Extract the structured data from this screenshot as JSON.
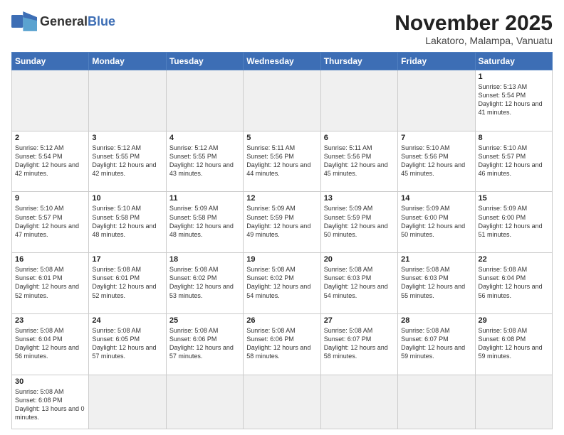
{
  "header": {
    "logo_general": "General",
    "logo_blue": "Blue",
    "month_title": "November 2025",
    "location": "Lakatoro, Malampa, Vanuatu"
  },
  "days_of_week": [
    "Sunday",
    "Monday",
    "Tuesday",
    "Wednesday",
    "Thursday",
    "Friday",
    "Saturday"
  ],
  "weeks": [
    [
      {
        "day": "",
        "info": "",
        "empty": true
      },
      {
        "day": "",
        "info": "",
        "empty": true
      },
      {
        "day": "",
        "info": "",
        "empty": true
      },
      {
        "day": "",
        "info": "",
        "empty": true
      },
      {
        "day": "",
        "info": "",
        "empty": true
      },
      {
        "day": "",
        "info": "",
        "empty": true
      },
      {
        "day": "1",
        "info": "Sunrise: 5:13 AM\nSunset: 5:54 PM\nDaylight: 12 hours\nand 41 minutes."
      }
    ],
    [
      {
        "day": "2",
        "info": "Sunrise: 5:12 AM\nSunset: 5:54 PM\nDaylight: 12 hours\nand 42 minutes."
      },
      {
        "day": "3",
        "info": "Sunrise: 5:12 AM\nSunset: 5:55 PM\nDaylight: 12 hours\nand 42 minutes."
      },
      {
        "day": "4",
        "info": "Sunrise: 5:12 AM\nSunset: 5:55 PM\nDaylight: 12 hours\nand 43 minutes."
      },
      {
        "day": "5",
        "info": "Sunrise: 5:11 AM\nSunset: 5:56 PM\nDaylight: 12 hours\nand 44 minutes."
      },
      {
        "day": "6",
        "info": "Sunrise: 5:11 AM\nSunset: 5:56 PM\nDaylight: 12 hours\nand 45 minutes."
      },
      {
        "day": "7",
        "info": "Sunrise: 5:10 AM\nSunset: 5:56 PM\nDaylight: 12 hours\nand 45 minutes."
      },
      {
        "day": "8",
        "info": "Sunrise: 5:10 AM\nSunset: 5:57 PM\nDaylight: 12 hours\nand 46 minutes."
      }
    ],
    [
      {
        "day": "9",
        "info": "Sunrise: 5:10 AM\nSunset: 5:57 PM\nDaylight: 12 hours\nand 47 minutes."
      },
      {
        "day": "10",
        "info": "Sunrise: 5:10 AM\nSunset: 5:58 PM\nDaylight: 12 hours\nand 48 minutes."
      },
      {
        "day": "11",
        "info": "Sunrise: 5:09 AM\nSunset: 5:58 PM\nDaylight: 12 hours\nand 48 minutes."
      },
      {
        "day": "12",
        "info": "Sunrise: 5:09 AM\nSunset: 5:59 PM\nDaylight: 12 hours\nand 49 minutes."
      },
      {
        "day": "13",
        "info": "Sunrise: 5:09 AM\nSunset: 5:59 PM\nDaylight: 12 hours\nand 50 minutes."
      },
      {
        "day": "14",
        "info": "Sunrise: 5:09 AM\nSunset: 6:00 PM\nDaylight: 12 hours\nand 50 minutes."
      },
      {
        "day": "15",
        "info": "Sunrise: 5:09 AM\nSunset: 6:00 PM\nDaylight: 12 hours\nand 51 minutes."
      }
    ],
    [
      {
        "day": "16",
        "info": "Sunrise: 5:08 AM\nSunset: 6:01 PM\nDaylight: 12 hours\nand 52 minutes."
      },
      {
        "day": "17",
        "info": "Sunrise: 5:08 AM\nSunset: 6:01 PM\nDaylight: 12 hours\nand 52 minutes."
      },
      {
        "day": "18",
        "info": "Sunrise: 5:08 AM\nSunset: 6:02 PM\nDaylight: 12 hours\nand 53 minutes."
      },
      {
        "day": "19",
        "info": "Sunrise: 5:08 AM\nSunset: 6:02 PM\nDaylight: 12 hours\nand 54 minutes."
      },
      {
        "day": "20",
        "info": "Sunrise: 5:08 AM\nSunset: 6:03 PM\nDaylight: 12 hours\nand 54 minutes."
      },
      {
        "day": "21",
        "info": "Sunrise: 5:08 AM\nSunset: 6:03 PM\nDaylight: 12 hours\nand 55 minutes."
      },
      {
        "day": "22",
        "info": "Sunrise: 5:08 AM\nSunset: 6:04 PM\nDaylight: 12 hours\nand 56 minutes."
      }
    ],
    [
      {
        "day": "23",
        "info": "Sunrise: 5:08 AM\nSunset: 6:04 PM\nDaylight: 12 hours\nand 56 minutes."
      },
      {
        "day": "24",
        "info": "Sunrise: 5:08 AM\nSunset: 6:05 PM\nDaylight: 12 hours\nand 57 minutes."
      },
      {
        "day": "25",
        "info": "Sunrise: 5:08 AM\nSunset: 6:06 PM\nDaylight: 12 hours\nand 57 minutes."
      },
      {
        "day": "26",
        "info": "Sunrise: 5:08 AM\nSunset: 6:06 PM\nDaylight: 12 hours\nand 58 minutes."
      },
      {
        "day": "27",
        "info": "Sunrise: 5:08 AM\nSunset: 6:07 PM\nDaylight: 12 hours\nand 58 minutes."
      },
      {
        "day": "28",
        "info": "Sunrise: 5:08 AM\nSunset: 6:07 PM\nDaylight: 12 hours\nand 59 minutes."
      },
      {
        "day": "29",
        "info": "Sunrise: 5:08 AM\nSunset: 6:08 PM\nDaylight: 12 hours\nand 59 minutes."
      }
    ],
    [
      {
        "day": "30",
        "info": "Sunrise: 5:08 AM\nSunset: 6:08 PM\nDaylight: 13 hours\nand 0 minutes.",
        "last": true
      },
      {
        "day": "",
        "info": "",
        "empty": true,
        "last": true
      },
      {
        "day": "",
        "info": "",
        "empty": true,
        "last": true
      },
      {
        "day": "",
        "info": "",
        "empty": true,
        "last": true
      },
      {
        "day": "",
        "info": "",
        "empty": true,
        "last": true
      },
      {
        "day": "",
        "info": "",
        "empty": true,
        "last": true
      },
      {
        "day": "",
        "info": "",
        "empty": true,
        "last": true
      }
    ]
  ]
}
